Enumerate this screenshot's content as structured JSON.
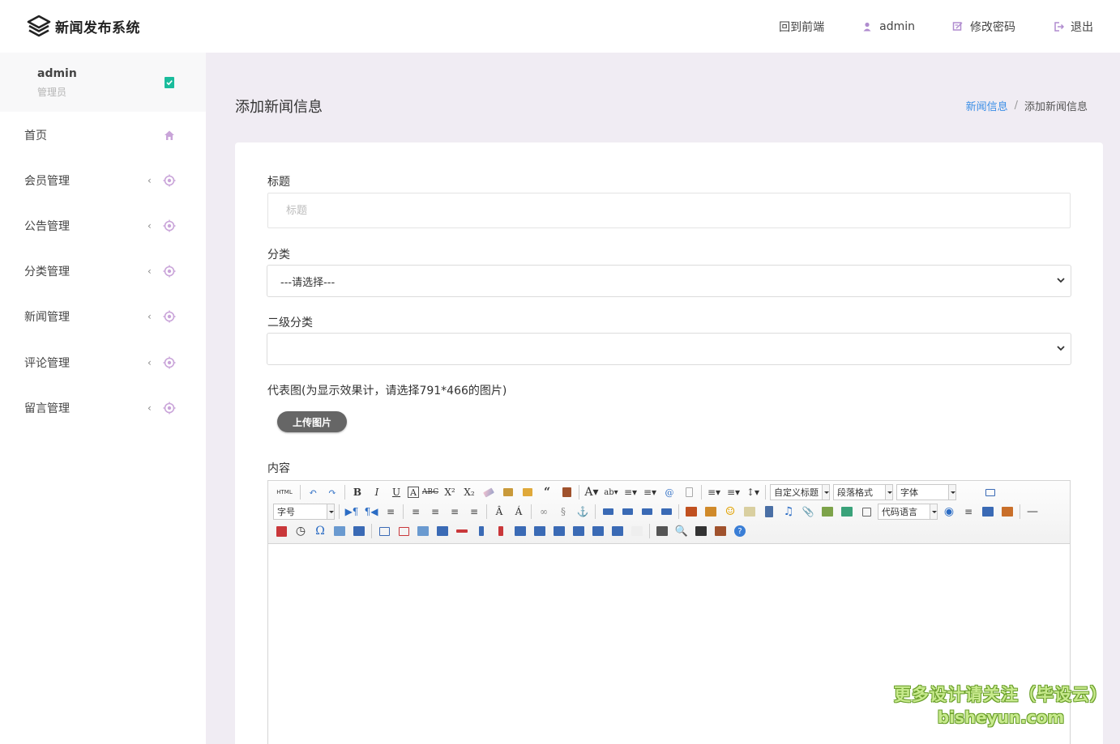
{
  "header": {
    "brand": "新闻发布系统",
    "nav": [
      {
        "label": "回到前端",
        "icon": "none"
      },
      {
        "label": "admin",
        "icon": "user-icon"
      },
      {
        "label": "修改密码",
        "icon": "edit-password-icon"
      },
      {
        "label": "退出",
        "icon": "logout-icon"
      }
    ]
  },
  "sidebar": {
    "user": {
      "name": "admin",
      "role": "管理员"
    },
    "menu": [
      {
        "label": "首页",
        "icon": "home-icon"
      },
      {
        "label": "会员管理",
        "icon": "target-icon"
      },
      {
        "label": "公告管理",
        "icon": "target-icon"
      },
      {
        "label": "分类管理",
        "icon": "target-icon"
      },
      {
        "label": "新闻管理",
        "icon": "target-icon"
      },
      {
        "label": "评论管理",
        "icon": "target-icon"
      },
      {
        "label": "留言管理",
        "icon": "target-icon"
      }
    ]
  },
  "page": {
    "title": "添加新闻信息",
    "breadcrumb": {
      "parent": "新闻信息",
      "sep": "/",
      "current": "添加新闻信息"
    }
  },
  "form": {
    "title_label": "标题",
    "title_placeholder": "标题",
    "category_label": "分类",
    "category_value": "---请选择---",
    "subcategory_label": "二级分类",
    "subcategory_value": "",
    "image_label": "代表图(为显示效果计，请选择791*466的图片)",
    "upload_label": "上传图片",
    "content_label": "内容"
  },
  "editor": {
    "combos": {
      "custom_title": "自定义标题",
      "paragraph": "段落格式",
      "font": "字体",
      "font_size": "字号",
      "code_lang": "代码语言"
    }
  },
  "watermark": {
    "line1": "更多设计请关注（毕设云）",
    "line2": "bisheyun.com"
  },
  "colors": {
    "accent": "#3a8ee6",
    "sidebar_icon": "#c9a4d9",
    "page_bg": "#f0ecf3",
    "check": "#1abc9c"
  }
}
